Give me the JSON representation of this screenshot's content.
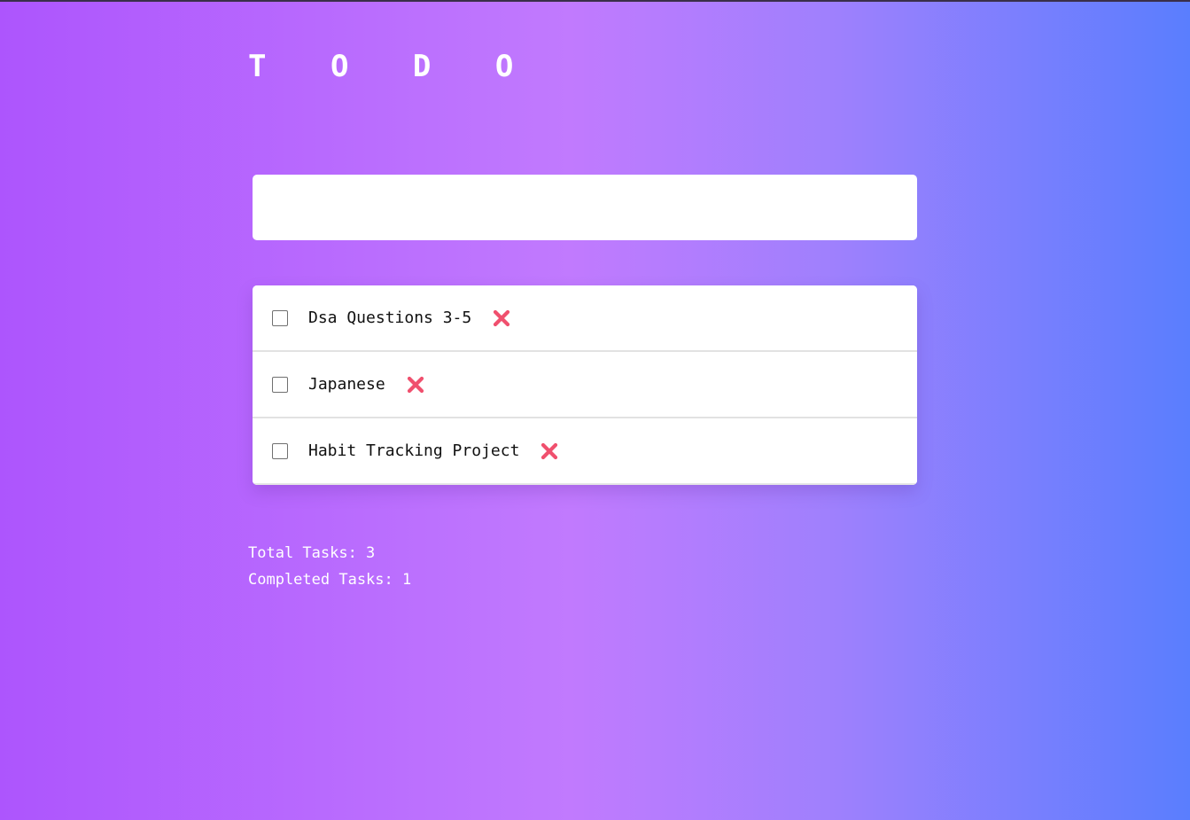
{
  "app": {
    "title": "T O D O"
  },
  "new_task_input": {
    "value": "",
    "placeholder": ""
  },
  "tasks": [
    {
      "text": "Dsa Questions 3-5",
      "completed": false,
      "delete_icon": "cross-mark-icon"
    },
    {
      "text": "Japanese",
      "completed": false,
      "delete_icon": "cross-mark-icon"
    },
    {
      "text": "Habit Tracking Project",
      "completed": false,
      "delete_icon": "cross-mark-icon"
    }
  ],
  "stats": {
    "total_label": "Total Tasks: 3",
    "completed_label": "Completed Tasks: 1"
  },
  "colors": {
    "background_gradient": [
      "#ad55fd",
      "#c17afe",
      "#9f80fd",
      "#5a7efe"
    ],
    "delete_icon": "#f0506e",
    "card": "#ffffff"
  }
}
